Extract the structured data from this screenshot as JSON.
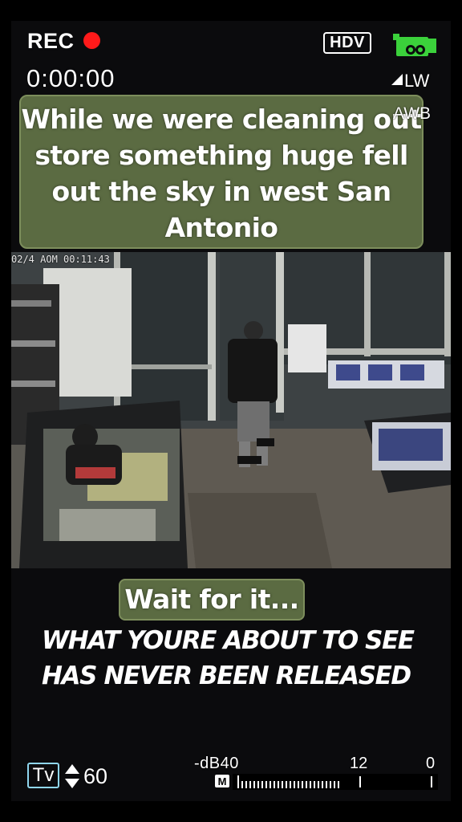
{
  "hud": {
    "rec_label": "REC",
    "timecode": "0:00:00",
    "format_badge": "HDV",
    "lw_label": "LW",
    "awb_label": "AWB",
    "mode_badge": "Tv",
    "shutter_value": "60",
    "db_label": "-dB40",
    "db_mid": "12",
    "db_max": "0",
    "meter_badge": "M",
    "colors": {
      "rec_dot": "#ff1a1a",
      "camera_icon": "#3bd13b",
      "tv_border": "#8fd6ee"
    },
    "icons": [
      "record-dot-icon",
      "video-camera-icon",
      "triangle-icon",
      "up-down-arrows-icon"
    ]
  },
  "captions": {
    "top": "While we were cleaning out store something huge fell out the sky in west San Antonio",
    "wait": "Wait for it..."
  },
  "video": {
    "timestamp_overlay": "02/4 AOM 00:11:43"
  },
  "headline": {
    "line1": "WHAT YOURE ABOUT TO SEE",
    "line2": "HAS NEVER BEEN RELEASED"
  }
}
